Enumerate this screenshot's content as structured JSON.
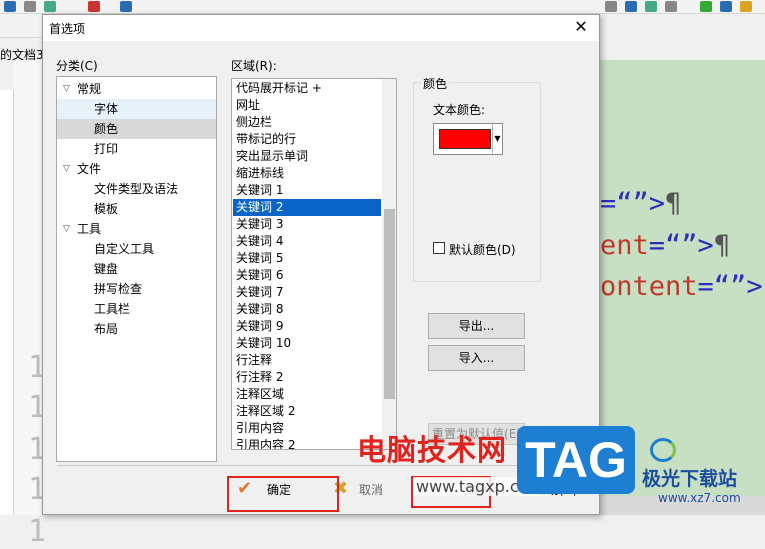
{
  "background": {
    "doc_tab": "的文档3.",
    "gutter_numbers": [
      "1",
      "1",
      "1",
      "1",
      "1"
    ],
    "code_lines": [
      {
        "attr": "",
        "text": "=“”>"
      },
      {
        "attr": "ent",
        "text": "=“”>"
      },
      {
        "attr": "ontent",
        "text": "=“”>"
      }
    ],
    "pilcrow": "¶"
  },
  "dialog": {
    "title": "首选项",
    "close_glyph": "✕",
    "category_label": "分类(C)",
    "area_label": "区域(R):",
    "tree": [
      {
        "label": "常规",
        "level": 0,
        "expanded": true
      },
      {
        "label": "字体",
        "level": 1
      },
      {
        "label": "颜色",
        "level": 1,
        "selected": true
      },
      {
        "label": "打印",
        "level": 1
      },
      {
        "label": "文件",
        "level": 0,
        "expanded": true
      },
      {
        "label": "文件类型及语法",
        "level": 1
      },
      {
        "label": "模板",
        "level": 1
      },
      {
        "label": "工具",
        "level": 0,
        "expanded": true
      },
      {
        "label": "自定义工具",
        "level": 1
      },
      {
        "label": "键盘",
        "level": 1
      },
      {
        "label": "拼写检查",
        "level": 1
      },
      {
        "label": "工具栏",
        "level": 1
      },
      {
        "label": "布局",
        "level": 1
      }
    ],
    "areas": [
      "代码展开标记 +",
      "网址",
      "侧边栏",
      "带标记的行",
      "突出显示单词",
      "缩进标线",
      "关键词 1",
      "关键词 2",
      "关键词 3",
      "关键词 4",
      "关键词 5",
      "关键词 6",
      "关键词 7",
      "关键词 8",
      "关键词 9",
      "关键词 10",
      "行注释",
      "行注释 2",
      "注释区域",
      "注释区域 2",
      "引用内容",
      "引用内容 2"
    ],
    "selected_area": "关键词 2",
    "color_group": {
      "title": "颜色",
      "text_color_label": "文本颜色:",
      "text_color": "#ff0000",
      "default_color_label": "默认颜色(D)"
    },
    "buttons": {
      "export": "导出...",
      "import": "导入...",
      "reset": "重置为默认值(E)",
      "ok": "确定",
      "cancel": "取消",
      "apply": "应用(A)",
      "help": "帮助(H)"
    }
  },
  "watermark": {
    "site_name": "电脑技术网",
    "site_url": "www.tagxp.com",
    "tag": "TAG",
    "logo_name": "极光下载站",
    "logo_url": "www.xz7.com"
  }
}
